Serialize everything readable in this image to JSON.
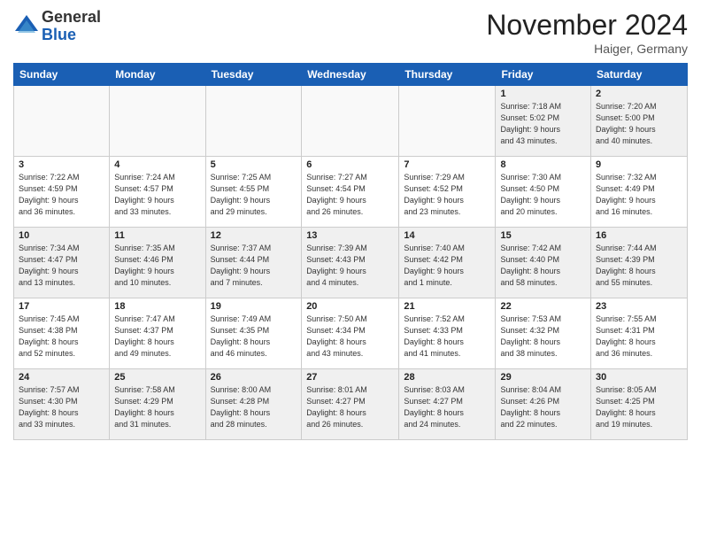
{
  "header": {
    "logo_general": "General",
    "logo_blue": "Blue",
    "month_title": "November 2024",
    "location": "Haiger, Germany"
  },
  "weekdays": [
    "Sunday",
    "Monday",
    "Tuesday",
    "Wednesday",
    "Thursday",
    "Friday",
    "Saturday"
  ],
  "weeks": [
    [
      {
        "day": "",
        "info": "",
        "empty": true
      },
      {
        "day": "",
        "info": "",
        "empty": true
      },
      {
        "day": "",
        "info": "",
        "empty": true
      },
      {
        "day": "",
        "info": "",
        "empty": true
      },
      {
        "day": "",
        "info": "",
        "empty": true
      },
      {
        "day": "1",
        "info": "Sunrise: 7:18 AM\nSunset: 5:02 PM\nDaylight: 9 hours\nand 43 minutes."
      },
      {
        "day": "2",
        "info": "Sunrise: 7:20 AM\nSunset: 5:00 PM\nDaylight: 9 hours\nand 40 minutes."
      }
    ],
    [
      {
        "day": "3",
        "info": "Sunrise: 7:22 AM\nSunset: 4:59 PM\nDaylight: 9 hours\nand 36 minutes."
      },
      {
        "day": "4",
        "info": "Sunrise: 7:24 AM\nSunset: 4:57 PM\nDaylight: 9 hours\nand 33 minutes."
      },
      {
        "day": "5",
        "info": "Sunrise: 7:25 AM\nSunset: 4:55 PM\nDaylight: 9 hours\nand 29 minutes."
      },
      {
        "day": "6",
        "info": "Sunrise: 7:27 AM\nSunset: 4:54 PM\nDaylight: 9 hours\nand 26 minutes."
      },
      {
        "day": "7",
        "info": "Sunrise: 7:29 AM\nSunset: 4:52 PM\nDaylight: 9 hours\nand 23 minutes."
      },
      {
        "day": "8",
        "info": "Sunrise: 7:30 AM\nSunset: 4:50 PM\nDaylight: 9 hours\nand 20 minutes."
      },
      {
        "day": "9",
        "info": "Sunrise: 7:32 AM\nSunset: 4:49 PM\nDaylight: 9 hours\nand 16 minutes."
      }
    ],
    [
      {
        "day": "10",
        "info": "Sunrise: 7:34 AM\nSunset: 4:47 PM\nDaylight: 9 hours\nand 13 minutes."
      },
      {
        "day": "11",
        "info": "Sunrise: 7:35 AM\nSunset: 4:46 PM\nDaylight: 9 hours\nand 10 minutes."
      },
      {
        "day": "12",
        "info": "Sunrise: 7:37 AM\nSunset: 4:44 PM\nDaylight: 9 hours\nand 7 minutes."
      },
      {
        "day": "13",
        "info": "Sunrise: 7:39 AM\nSunset: 4:43 PM\nDaylight: 9 hours\nand 4 minutes."
      },
      {
        "day": "14",
        "info": "Sunrise: 7:40 AM\nSunset: 4:42 PM\nDaylight: 9 hours\nand 1 minute."
      },
      {
        "day": "15",
        "info": "Sunrise: 7:42 AM\nSunset: 4:40 PM\nDaylight: 8 hours\nand 58 minutes."
      },
      {
        "day": "16",
        "info": "Sunrise: 7:44 AM\nSunset: 4:39 PM\nDaylight: 8 hours\nand 55 minutes."
      }
    ],
    [
      {
        "day": "17",
        "info": "Sunrise: 7:45 AM\nSunset: 4:38 PM\nDaylight: 8 hours\nand 52 minutes."
      },
      {
        "day": "18",
        "info": "Sunrise: 7:47 AM\nSunset: 4:37 PM\nDaylight: 8 hours\nand 49 minutes."
      },
      {
        "day": "19",
        "info": "Sunrise: 7:49 AM\nSunset: 4:35 PM\nDaylight: 8 hours\nand 46 minutes."
      },
      {
        "day": "20",
        "info": "Sunrise: 7:50 AM\nSunset: 4:34 PM\nDaylight: 8 hours\nand 43 minutes."
      },
      {
        "day": "21",
        "info": "Sunrise: 7:52 AM\nSunset: 4:33 PM\nDaylight: 8 hours\nand 41 minutes."
      },
      {
        "day": "22",
        "info": "Sunrise: 7:53 AM\nSunset: 4:32 PM\nDaylight: 8 hours\nand 38 minutes."
      },
      {
        "day": "23",
        "info": "Sunrise: 7:55 AM\nSunset: 4:31 PM\nDaylight: 8 hours\nand 36 minutes."
      }
    ],
    [
      {
        "day": "24",
        "info": "Sunrise: 7:57 AM\nSunset: 4:30 PM\nDaylight: 8 hours\nand 33 minutes."
      },
      {
        "day": "25",
        "info": "Sunrise: 7:58 AM\nSunset: 4:29 PM\nDaylight: 8 hours\nand 31 minutes."
      },
      {
        "day": "26",
        "info": "Sunrise: 8:00 AM\nSunset: 4:28 PM\nDaylight: 8 hours\nand 28 minutes."
      },
      {
        "day": "27",
        "info": "Sunrise: 8:01 AM\nSunset: 4:27 PM\nDaylight: 8 hours\nand 26 minutes."
      },
      {
        "day": "28",
        "info": "Sunrise: 8:03 AM\nSunset: 4:27 PM\nDaylight: 8 hours\nand 24 minutes."
      },
      {
        "day": "29",
        "info": "Sunrise: 8:04 AM\nSunset: 4:26 PM\nDaylight: 8 hours\nand 22 minutes."
      },
      {
        "day": "30",
        "info": "Sunrise: 8:05 AM\nSunset: 4:25 PM\nDaylight: 8 hours\nand 19 minutes."
      }
    ]
  ]
}
